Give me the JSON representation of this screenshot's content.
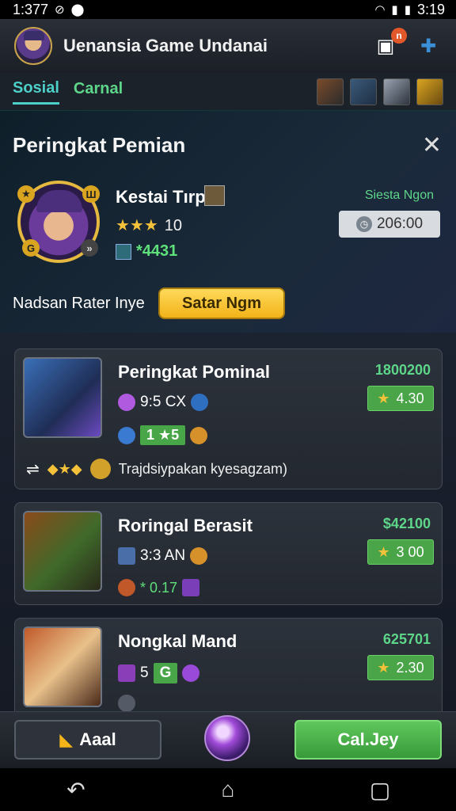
{
  "status_bar": {
    "time": "1:377",
    "clock": "3:19"
  },
  "header": {
    "title": "Uenansia Game Undanai",
    "badge": "n"
  },
  "tabs": [
    {
      "label": "Sosial"
    },
    {
      "label": "Carnal"
    }
  ],
  "panel": {
    "title": "Peringkat Pemian",
    "player_name": "Kestai Tırp",
    "stars": "★★★",
    "rating": "10",
    "score": "*4431",
    "status_label": "Siesta Ngon",
    "timer": "206:00",
    "subtitle": "Nadsan Rater Inye",
    "start_label": "Satar Ngm"
  },
  "cards": [
    {
      "title": "Peringkat Pominal",
      "value": "1800200",
      "rating": "4.30",
      "sub_text": "9:5 CX",
      "chip": "1 ★5",
      "desc": "Trajdsiypakan kyesagzam)"
    },
    {
      "title": "Roringal Berasit",
      "value": "$42100",
      "rating": "3 00",
      "sub_text": "3:3 AN",
      "row3": "* 0.17"
    },
    {
      "title": "Nongkal Mand",
      "value": "625701",
      "rating": "2.30",
      "sub_text": "5",
      "chip": "G"
    }
  ],
  "bottom": {
    "back_label": "Aaal",
    "confirm_label": "Cal.Jey"
  },
  "colors": {
    "accent_green": "#5ed68a",
    "gold": "#f2b319",
    "tab_teal": "#4dd0c8"
  }
}
